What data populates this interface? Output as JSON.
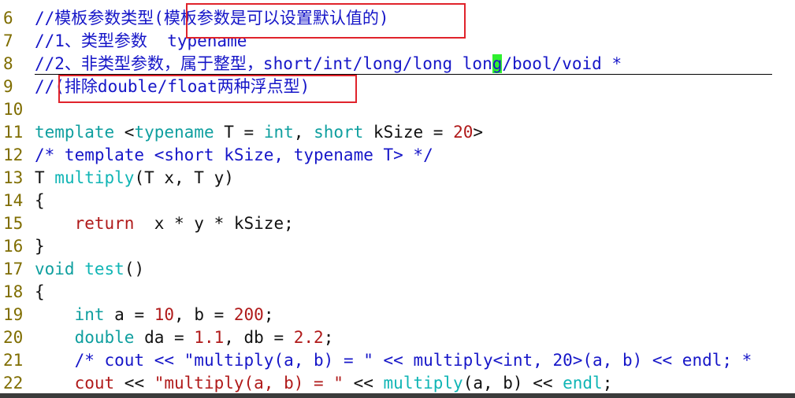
{
  "colors": {
    "comment": "#1616c8",
    "keyword": "#0f9f9f",
    "number": "#b01a1a",
    "function": "#10b5b5",
    "line_number": "#7f6d00",
    "text": "#111111",
    "highlight_box": "#e0232b",
    "cursor": "#2ff02f"
  },
  "lines": [
    {
      "n": "6",
      "segs": [
        {
          "t": "//模板参数类型(模板参数是可以设置默认值的)",
          "c": "comment"
        }
      ]
    },
    {
      "n": "7",
      "segs": [
        {
          "t": "//1、类型参数  typename",
          "c": "comment"
        }
      ]
    },
    {
      "n": "8",
      "segs": [
        {
          "t": "//2、非类型参数，属于整型，short/int/long/long lon",
          "c": "comment"
        },
        {
          "t": "g",
          "c": "cursor"
        },
        {
          "t": "/bool/void *",
          "c": "comment"
        }
      ]
    },
    {
      "n": "9",
      "segs": [
        {
          "t": "//(排除double/float两种浮点型)",
          "c": "comment"
        }
      ]
    },
    {
      "n": "10",
      "segs": []
    },
    {
      "n": "11",
      "segs": [
        {
          "t": "template",
          "c": "keyword"
        },
        {
          "t": " <",
          "c": "text"
        },
        {
          "t": "typename",
          "c": "keyword"
        },
        {
          "t": " T = ",
          "c": "text"
        },
        {
          "t": "int",
          "c": "keyword"
        },
        {
          "t": ", ",
          "c": "text"
        },
        {
          "t": "short",
          "c": "keyword"
        },
        {
          "t": " kSize = ",
          "c": "text"
        },
        {
          "t": "20",
          "c": "number"
        },
        {
          "t": ">",
          "c": "text"
        }
      ]
    },
    {
      "n": "12",
      "segs": [
        {
          "t": "/* template <short kSize, typename T> */",
          "c": "comment"
        }
      ]
    },
    {
      "n": "13",
      "segs": [
        {
          "t": "T ",
          "c": "text"
        },
        {
          "t": "multiply",
          "c": "function"
        },
        {
          "t": "(T x, T y)",
          "c": "text"
        }
      ]
    },
    {
      "n": "14",
      "segs": [
        {
          "t": "{",
          "c": "text"
        }
      ]
    },
    {
      "n": "15",
      "segs": [
        {
          "t": "    ",
          "c": "text"
        },
        {
          "t": "return",
          "c": "number"
        },
        {
          "t": "  x * y * kSize;",
          "c": "text"
        }
      ]
    },
    {
      "n": "16",
      "segs": [
        {
          "t": "}",
          "c": "text"
        }
      ]
    },
    {
      "n": "17",
      "segs": [
        {
          "t": "void",
          "c": "keyword"
        },
        {
          "t": " ",
          "c": "text"
        },
        {
          "t": "test",
          "c": "function"
        },
        {
          "t": "()",
          "c": "text"
        }
      ]
    },
    {
      "n": "18",
      "segs": [
        {
          "t": "{",
          "c": "text"
        }
      ]
    },
    {
      "n": "19",
      "segs": [
        {
          "t": "    ",
          "c": "text"
        },
        {
          "t": "int",
          "c": "keyword"
        },
        {
          "t": " a = ",
          "c": "text"
        },
        {
          "t": "10",
          "c": "number"
        },
        {
          "t": ", b = ",
          "c": "text"
        },
        {
          "t": "200",
          "c": "number"
        },
        {
          "t": ";",
          "c": "text"
        }
      ]
    },
    {
      "n": "20",
      "segs": [
        {
          "t": "    ",
          "c": "text"
        },
        {
          "t": "double",
          "c": "keyword"
        },
        {
          "t": " da = ",
          "c": "text"
        },
        {
          "t": "1.1",
          "c": "number"
        },
        {
          "t": ", db = ",
          "c": "text"
        },
        {
          "t": "2.2",
          "c": "number"
        },
        {
          "t": ";",
          "c": "text"
        }
      ]
    },
    {
      "n": "21",
      "segs": [
        {
          "t": "    ",
          "c": "text"
        },
        {
          "t": "/* cout << \"multiply(a, b) = \" << multiply<int, 20>(a, b) << endl; *",
          "c": "comment"
        }
      ]
    },
    {
      "n": "22",
      "segs": [
        {
          "t": "    ",
          "c": "text"
        },
        {
          "t": "cout",
          "c": "number"
        },
        {
          "t": " << ",
          "c": "text"
        },
        {
          "t": "\"multiply(a, b) = \"",
          "c": "number"
        },
        {
          "t": " << ",
          "c": "text"
        },
        {
          "t": "multiply",
          "c": "function"
        },
        {
          "t": "(a, b) << ",
          "c": "text"
        },
        {
          "t": "endl",
          "c": "function"
        },
        {
          "t": ";",
          "c": "text"
        }
      ]
    }
  ]
}
